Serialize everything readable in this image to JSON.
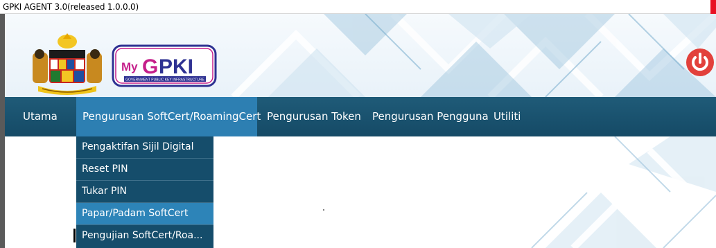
{
  "window": {
    "title": "GPKI AGENT 3.0(released 1.0.0.0)"
  },
  "header": {
    "crest_icon": "malaysia-coat-of-arms",
    "logo_text": "MyGPKI",
    "logo_caption": "GOVERNMENT PUBLIC KEY INFRASTRUCTURE",
    "power_icon": "power-icon",
    "colors": {
      "navbar": "#1a5472",
      "accent": "#2d7fb2",
      "power": "#e2403b"
    }
  },
  "nav": {
    "items": [
      {
        "label": "Utama"
      },
      {
        "label": "Pengurusan SoftCert/RoamingCert"
      },
      {
        "label": "Pengurusan Token"
      },
      {
        "label": "Pengurusan Pengguna"
      },
      {
        "label": "Utiliti"
      }
    ],
    "active_index": 1
  },
  "dropdown": {
    "items": [
      {
        "label": "Pengaktifan Sijil Digital"
      },
      {
        "label": "Reset PIN"
      },
      {
        "label": "Tukar PIN"
      },
      {
        "label": "Papar/Padam SoftCert"
      },
      {
        "label": "Pengujian SoftCert/Roa..."
      }
    ],
    "hovered_index": 3
  }
}
